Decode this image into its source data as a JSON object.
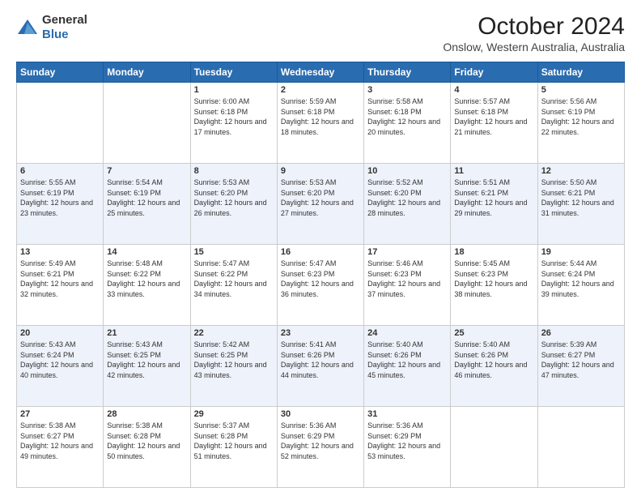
{
  "header": {
    "logo_line1": "General",
    "logo_line2": "Blue",
    "title": "October 2024",
    "subtitle": "Onslow, Western Australia, Australia"
  },
  "days_of_week": [
    "Sunday",
    "Monday",
    "Tuesday",
    "Wednesday",
    "Thursday",
    "Friday",
    "Saturday"
  ],
  "weeks": [
    [
      {
        "num": "",
        "info": ""
      },
      {
        "num": "",
        "info": ""
      },
      {
        "num": "1",
        "info": "Sunrise: 6:00 AM\nSunset: 6:18 PM\nDaylight: 12 hours and 17 minutes."
      },
      {
        "num": "2",
        "info": "Sunrise: 5:59 AM\nSunset: 6:18 PM\nDaylight: 12 hours and 18 minutes."
      },
      {
        "num": "3",
        "info": "Sunrise: 5:58 AM\nSunset: 6:18 PM\nDaylight: 12 hours and 20 minutes."
      },
      {
        "num": "4",
        "info": "Sunrise: 5:57 AM\nSunset: 6:18 PM\nDaylight: 12 hours and 21 minutes."
      },
      {
        "num": "5",
        "info": "Sunrise: 5:56 AM\nSunset: 6:19 PM\nDaylight: 12 hours and 22 minutes."
      }
    ],
    [
      {
        "num": "6",
        "info": "Sunrise: 5:55 AM\nSunset: 6:19 PM\nDaylight: 12 hours and 23 minutes."
      },
      {
        "num": "7",
        "info": "Sunrise: 5:54 AM\nSunset: 6:19 PM\nDaylight: 12 hours and 25 minutes."
      },
      {
        "num": "8",
        "info": "Sunrise: 5:53 AM\nSunset: 6:20 PM\nDaylight: 12 hours and 26 minutes."
      },
      {
        "num": "9",
        "info": "Sunrise: 5:53 AM\nSunset: 6:20 PM\nDaylight: 12 hours and 27 minutes."
      },
      {
        "num": "10",
        "info": "Sunrise: 5:52 AM\nSunset: 6:20 PM\nDaylight: 12 hours and 28 minutes."
      },
      {
        "num": "11",
        "info": "Sunrise: 5:51 AM\nSunset: 6:21 PM\nDaylight: 12 hours and 29 minutes."
      },
      {
        "num": "12",
        "info": "Sunrise: 5:50 AM\nSunset: 6:21 PM\nDaylight: 12 hours and 31 minutes."
      }
    ],
    [
      {
        "num": "13",
        "info": "Sunrise: 5:49 AM\nSunset: 6:21 PM\nDaylight: 12 hours and 32 minutes."
      },
      {
        "num": "14",
        "info": "Sunrise: 5:48 AM\nSunset: 6:22 PM\nDaylight: 12 hours and 33 minutes."
      },
      {
        "num": "15",
        "info": "Sunrise: 5:47 AM\nSunset: 6:22 PM\nDaylight: 12 hours and 34 minutes."
      },
      {
        "num": "16",
        "info": "Sunrise: 5:47 AM\nSunset: 6:23 PM\nDaylight: 12 hours and 36 minutes."
      },
      {
        "num": "17",
        "info": "Sunrise: 5:46 AM\nSunset: 6:23 PM\nDaylight: 12 hours and 37 minutes."
      },
      {
        "num": "18",
        "info": "Sunrise: 5:45 AM\nSunset: 6:23 PM\nDaylight: 12 hours and 38 minutes."
      },
      {
        "num": "19",
        "info": "Sunrise: 5:44 AM\nSunset: 6:24 PM\nDaylight: 12 hours and 39 minutes."
      }
    ],
    [
      {
        "num": "20",
        "info": "Sunrise: 5:43 AM\nSunset: 6:24 PM\nDaylight: 12 hours and 40 minutes."
      },
      {
        "num": "21",
        "info": "Sunrise: 5:43 AM\nSunset: 6:25 PM\nDaylight: 12 hours and 42 minutes."
      },
      {
        "num": "22",
        "info": "Sunrise: 5:42 AM\nSunset: 6:25 PM\nDaylight: 12 hours and 43 minutes."
      },
      {
        "num": "23",
        "info": "Sunrise: 5:41 AM\nSunset: 6:26 PM\nDaylight: 12 hours and 44 minutes."
      },
      {
        "num": "24",
        "info": "Sunrise: 5:40 AM\nSunset: 6:26 PM\nDaylight: 12 hours and 45 minutes."
      },
      {
        "num": "25",
        "info": "Sunrise: 5:40 AM\nSunset: 6:26 PM\nDaylight: 12 hours and 46 minutes."
      },
      {
        "num": "26",
        "info": "Sunrise: 5:39 AM\nSunset: 6:27 PM\nDaylight: 12 hours and 47 minutes."
      }
    ],
    [
      {
        "num": "27",
        "info": "Sunrise: 5:38 AM\nSunset: 6:27 PM\nDaylight: 12 hours and 49 minutes."
      },
      {
        "num": "28",
        "info": "Sunrise: 5:38 AM\nSunset: 6:28 PM\nDaylight: 12 hours and 50 minutes."
      },
      {
        "num": "29",
        "info": "Sunrise: 5:37 AM\nSunset: 6:28 PM\nDaylight: 12 hours and 51 minutes."
      },
      {
        "num": "30",
        "info": "Sunrise: 5:36 AM\nSunset: 6:29 PM\nDaylight: 12 hours and 52 minutes."
      },
      {
        "num": "31",
        "info": "Sunrise: 5:36 AM\nSunset: 6:29 PM\nDaylight: 12 hours and 53 minutes."
      },
      {
        "num": "",
        "info": ""
      },
      {
        "num": "",
        "info": ""
      }
    ]
  ]
}
